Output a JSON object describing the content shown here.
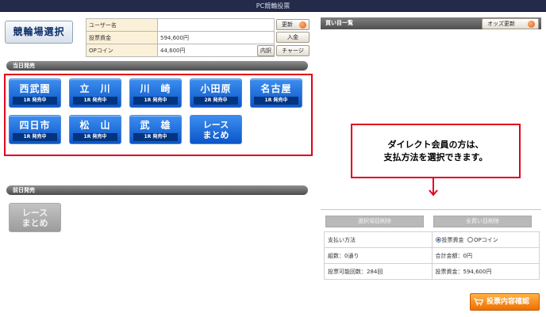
{
  "window": {
    "title": "PC競輪投票"
  },
  "left": {
    "venue_select_label": "競輪場選択",
    "account": [
      {
        "label": "ユーザー名",
        "value": ""
      },
      {
        "label": "投票資金",
        "value": "594,600円"
      },
      {
        "label": "OPコイン",
        "value": "44,600円"
      }
    ],
    "buttons": {
      "refresh": "更新",
      "deposit": "入金",
      "detail": "内訳",
      "charge": "チャージ"
    },
    "today_label": "当日発売",
    "venues": [
      {
        "name": "西武園",
        "status": "1R 発売中"
      },
      {
        "name": "立　川",
        "status": "1R 発売中"
      },
      {
        "name": "川　崎",
        "status": "1R 発売中"
      },
      {
        "name": "小田原",
        "status": "2R 発売中"
      },
      {
        "name": "名古屋",
        "status": "1R 発売中"
      },
      {
        "name": "四日市",
        "status": "1R 発売中"
      },
      {
        "name": "松　山",
        "status": "1R 発売中"
      },
      {
        "name": "武　雄",
        "status": "1R 発売中"
      }
    ],
    "race_summary": {
      "line1": "レース",
      "line2": "まとめ"
    },
    "prev_label": "前日発売"
  },
  "right": {
    "bet_list_title": "買い目一覧",
    "odds_refresh": "オッズ更新",
    "callout": {
      "line1": "ダイレクト会員の方は、",
      "line2": "支払方法を選択できます。"
    },
    "delete_selected": "選択項目削除",
    "delete_all": "全買い目削除",
    "pay_method_label": "支払い方法",
    "pay_options": {
      "opt1": "投票資金",
      "opt2": "OPコイン"
    },
    "combo_count": "組数：0通り",
    "total": "合計金額：0円",
    "available_count": "投票可能回数：284回",
    "funds": "投票資金：594,600円",
    "confirm": "投票内容確認"
  },
  "colors": {
    "title_bar": "#232a4a",
    "venue_blue": "#0a55c8",
    "highlight_red": "#e3001b",
    "confirm_orange": "#ee6f00"
  }
}
